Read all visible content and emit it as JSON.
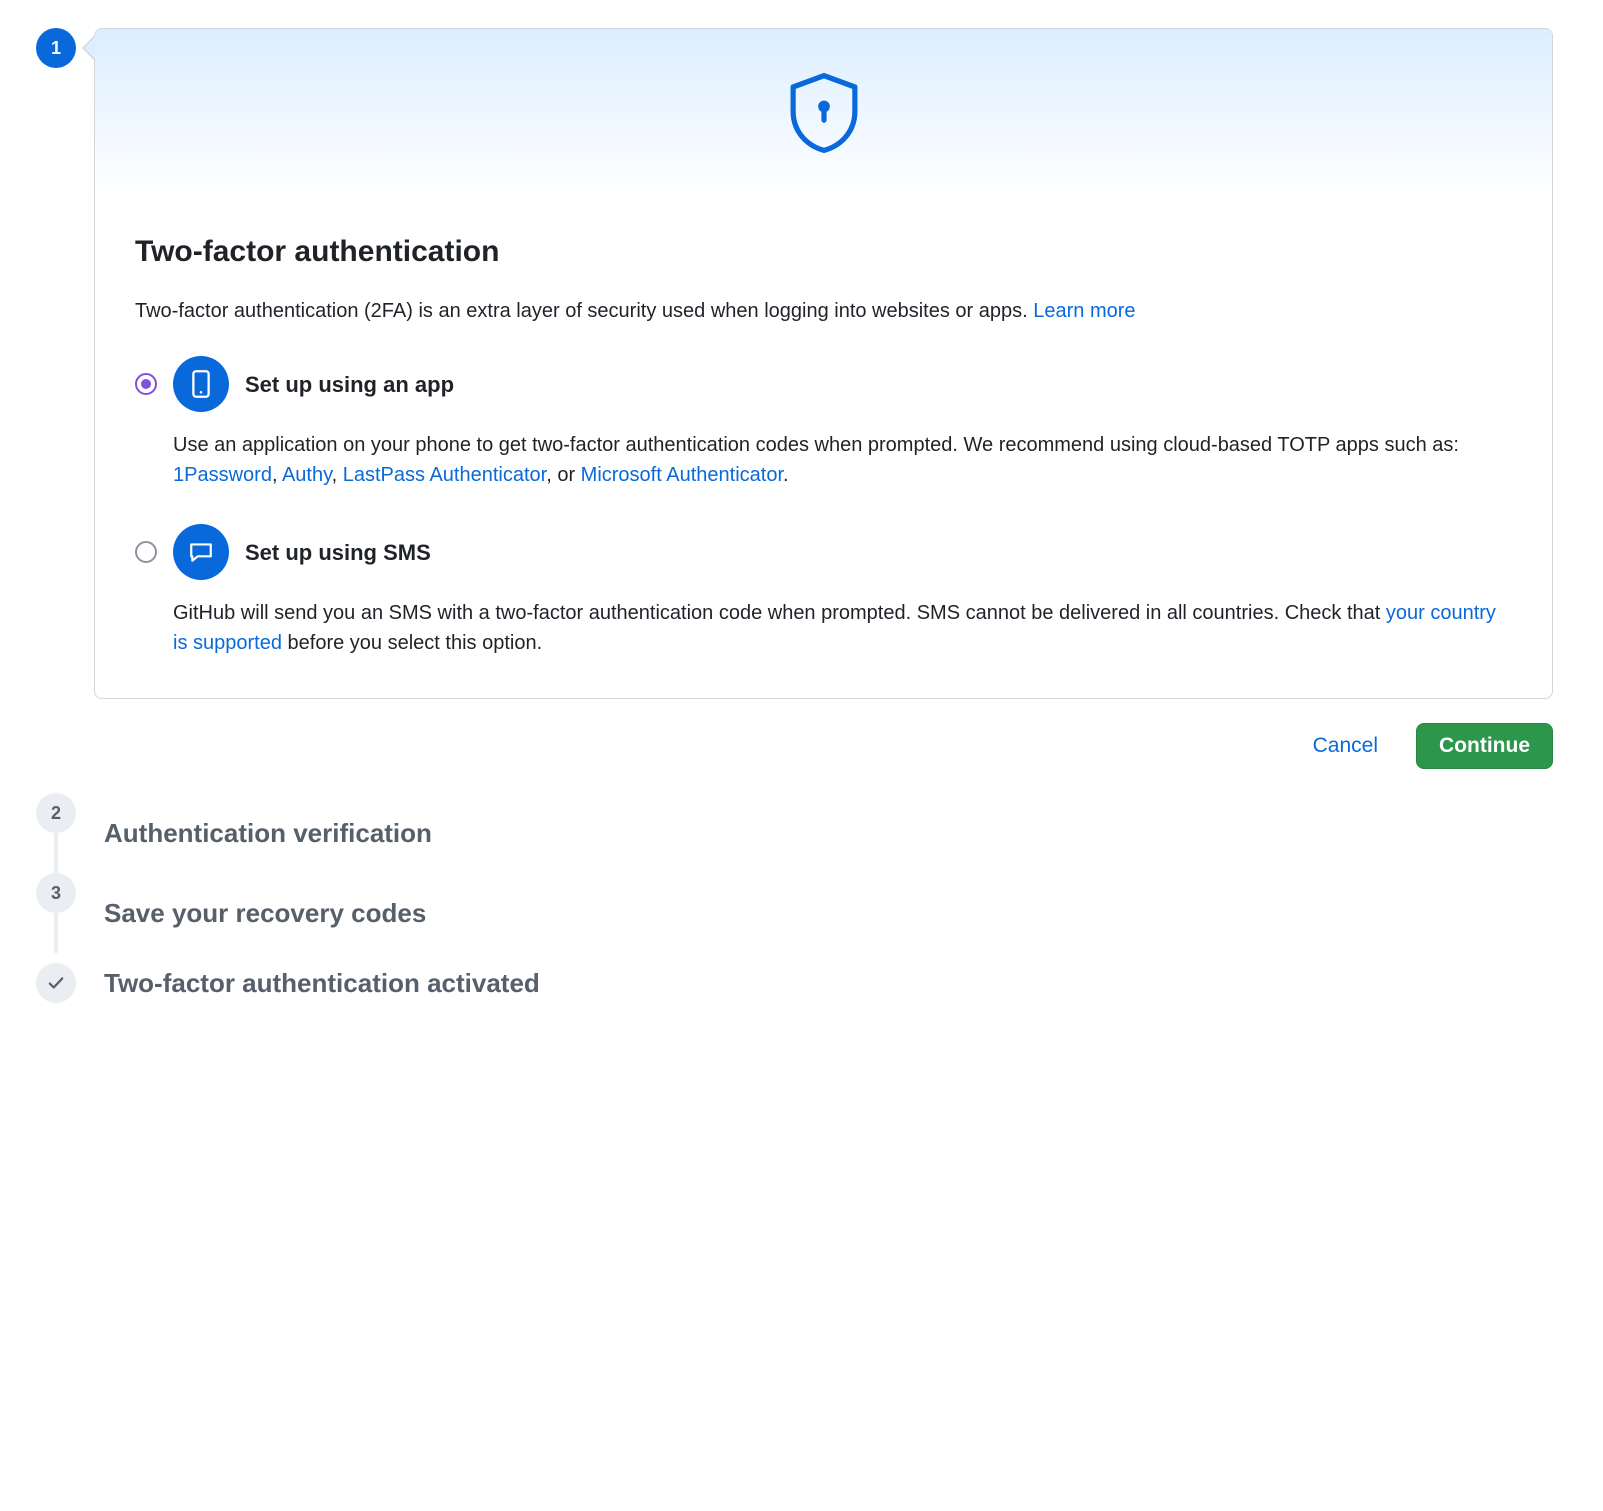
{
  "steps": {
    "s1": {
      "num": "1"
    },
    "s2": {
      "num": "2",
      "title": "Authentication verification"
    },
    "s3": {
      "num": "3",
      "title": "Save your recovery codes"
    },
    "s4": {
      "title": "Two-factor authentication activated"
    }
  },
  "card": {
    "title": "Two-factor authentication",
    "sub_prefix": "Two-factor authentication (2FA) is an extra layer of security used when logging into websites or apps. ",
    "learn_more": "Learn more"
  },
  "option_app": {
    "title": "Set up using an app",
    "desc_prefix": "Use an application on your phone to get two-factor authentication codes when prompted. We recommend using cloud-based TOTP apps such as: ",
    "link_1password": "1Password",
    "link_authy": "Authy",
    "link_lastpass": "LastPass Authenticator",
    "link_msauth": "Microsoft Authenticator",
    "comma": ", ",
    "or": ", or ",
    "period": "."
  },
  "option_sms": {
    "title": "Set up using SMS",
    "desc_prefix": "GitHub will send you an SMS with a two-factor authentication code when prompted. SMS cannot be delivered in all countries. Check that ",
    "link_country": "your country is supported",
    "desc_suffix": " before you select this option."
  },
  "actions": {
    "cancel": "Cancel",
    "continue": "Continue"
  }
}
